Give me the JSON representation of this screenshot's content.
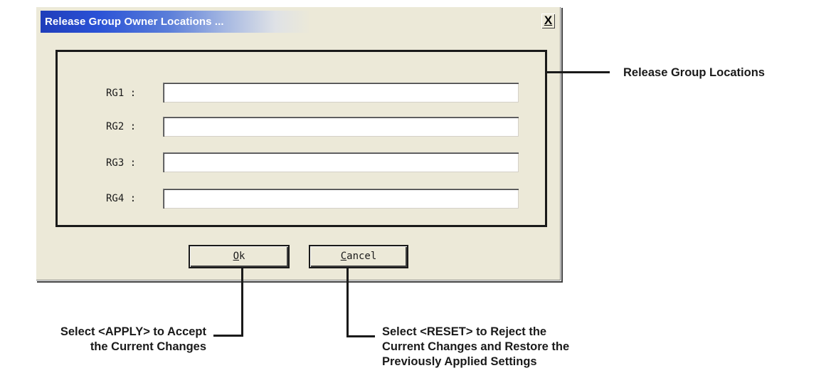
{
  "dialog": {
    "title": "Release Group Owner Locations ...",
    "close_label": "X",
    "fields": [
      {
        "label": "RG1 :",
        "value": ""
      },
      {
        "label": "RG2 :",
        "value": ""
      },
      {
        "label": "RG3 :",
        "value": ""
      },
      {
        "label": "RG4 :",
        "value": ""
      }
    ],
    "ok_button": {
      "mnemonic": "O",
      "rest": "k"
    },
    "cancel_button": {
      "mnemonic": "C",
      "rest": "ancel"
    }
  },
  "callouts": {
    "group_locations": "Release Group Locations",
    "apply": {
      "line1": "Select <APPLY> to Accept",
      "line2": "the Current Changes"
    },
    "reset": {
      "line1": "Select <RESET> to Reject the",
      "line2": "Current Changes and Restore the",
      "line3": "Previously Applied Settings"
    }
  }
}
